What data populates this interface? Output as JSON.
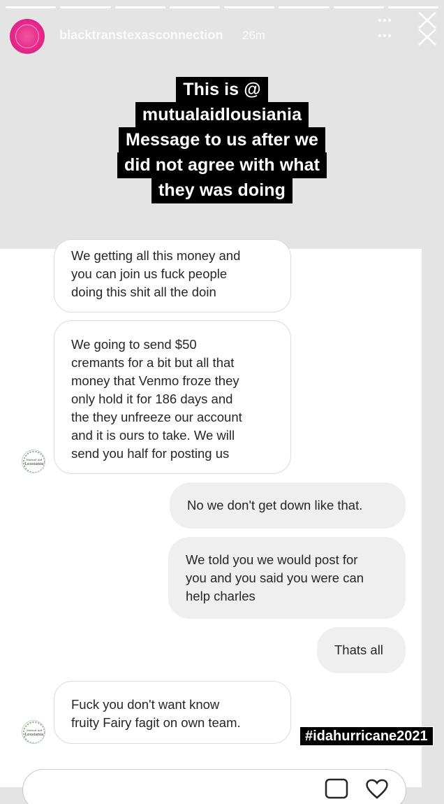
{
  "header": {
    "username": "blacktranstexasconnection",
    "time_ago": "26m"
  },
  "caption": {
    "lines": [
      "This is @",
      "mutualaidlousiania",
      "Message to us after we",
      "did not agree with what",
      "they was doing"
    ]
  },
  "sender_avatar_text": "Mutual Aid Lousiania",
  "messages": [
    {
      "side": "incoming",
      "text": "We getting all this money and\nyou can join us fuck people\ndoing this shit all the doin"
    },
    {
      "side": "incoming",
      "text": "We going to send $50\ncremants for a bit but all that\nmoney that Venmo froze they\nonly hold it for 186 days and\nthe they unfreeze our account\nand it is ours to take. We will\nsend you half for posting us"
    },
    {
      "side": "outgoing",
      "text": "No we don't get down like that."
    },
    {
      "side": "outgoing",
      "text": "We told you we would post for\nyou and you said you were can\nhelp charles"
    },
    {
      "side": "outgoing",
      "text": "Thats all"
    },
    {
      "side": "incoming",
      "text": "Fuck you don't want know\nfruity Fairy fagit on own team."
    }
  ],
  "hashtag": "#idahurricane2021",
  "icons": [
    "more-icon",
    "close-icon",
    "photo-icon",
    "heart-icon"
  ]
}
